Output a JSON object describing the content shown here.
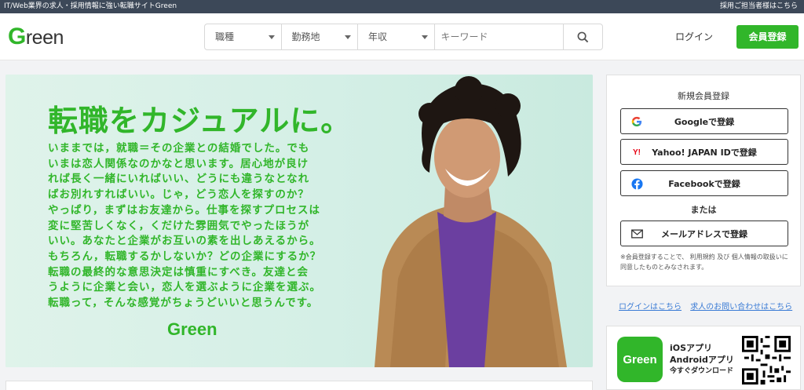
{
  "topbar": {
    "tagline": "IT/Web業界の求人・採用情報に強い転職サイトGreen",
    "employer_link": "採用ご担当者様はこちら"
  },
  "header": {
    "logo_text": "Green",
    "search": {
      "job_type": "職種",
      "location": "勤務地",
      "salary": "年収",
      "keyword_placeholder": "キーワード"
    },
    "login_label": "ログイン",
    "register_label": "会員登録"
  },
  "hero": {
    "title": "転職をカジュアルに。",
    "body_lines": [
      "いままでは，就職＝その企業との結婚でした。でも",
      "いまは恋人関係なのかなと思います。居心地が良け",
      "れば長く一緒にいればいい、どうにも違うなとなれ",
      "ばお別れすればいい。じゃ，どう恋人を探すのか？",
      "やっぱり，まずはお友達から。仕事を探すプロセスは",
      "変に堅苦しくなく，くだけた雰囲気でやったほうが",
      "いい。あなたと企業がお互いの素を出しあえるから。",
      "もちろん，転職するかしないか？どの企業にするか？",
      "転職の最終的な意思決定は慎重にすべき。友達と会",
      "うように企業と会い，恋人を選ぶように企業を選ぶ。",
      "転職って，そんな感覚がちょうどいいと思うんです。"
    ],
    "logo_text": "Green"
  },
  "signup": {
    "title": "新規会員登録",
    "google_label": "Googleで登録",
    "yahoo_label": "Yahoo! JAPAN IDで登録",
    "facebook_label": "Facebookで登録",
    "or_label": "または",
    "email_label": "メールアドレスで登録",
    "note": "※会員登録することで、 利用規約 及び 個人情報の取扱いに同意したものとみなされます。"
  },
  "links": {
    "login": "ログインはこちら",
    "contact": "求人のお問い合わせはこちら"
  },
  "app": {
    "icon_text": "Green",
    "line1": "iOSアプリ",
    "line2": "Androidアプリ",
    "line3": "今すぐダウンロード"
  },
  "colors": {
    "brand_green": "#31b62a",
    "topbar": "#3c4858",
    "link_blue": "#3a7bd5"
  }
}
